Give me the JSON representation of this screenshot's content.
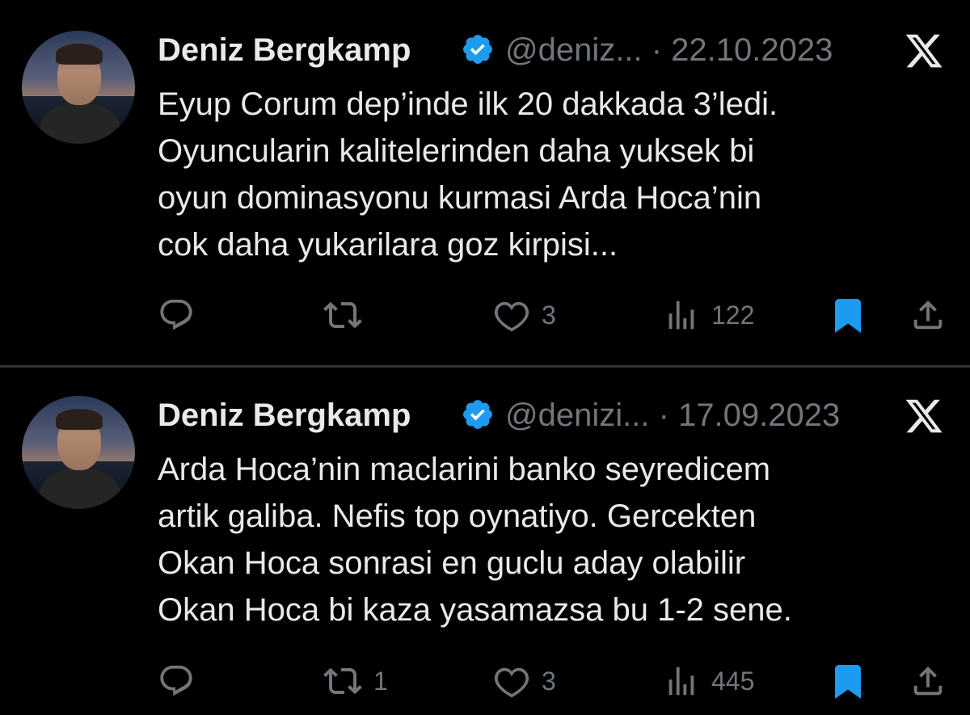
{
  "tweets": [
    {
      "author_name": "Deniz Bergkamp",
      "handle": "@deniz...",
      "separator": "·",
      "date": "22.10.2023",
      "text_lines": [
        "Eyup Corum dep’inde ilk 20 dakkada 3’ledi.",
        "Oyuncularin kalitelerinden daha yuksek bi",
        "oyun dominasyonu kurmasi Arda Hoca’nin",
        "cok daha yukarilara goz kirpisi..."
      ],
      "replies": "",
      "retweets": "",
      "likes": "3",
      "views": "122"
    },
    {
      "author_name": "Deniz Bergkamp",
      "handle": "@denizi...",
      "separator": "·",
      "date": "17.09.2023",
      "text_lines": [
        "Arda Hoca’nin maclarini banko seyredicem",
        "artik galiba. Nefis top oynatiyo. Gercekten",
        "Okan Hoca sonrasi en guclu aday olabilir",
        "Okan Hoca bi kaza yasamazsa bu 1-2 sene."
      ],
      "replies": "",
      "retweets": "1",
      "likes": "3",
      "views": "445"
    }
  ],
  "icons": {
    "verified": "verified-badge-icon",
    "platform": "x-logo-icon",
    "reply": "reply-icon",
    "retweet": "retweet-icon",
    "like": "heart-icon",
    "views": "views-icon",
    "bookmark": "bookmark-icon",
    "share": "share-icon"
  },
  "colors": {
    "background": "#000000",
    "text": "#e7e9ea",
    "muted": "#71767b",
    "accent": "#1d9bf0",
    "divider": "#2f3336"
  }
}
